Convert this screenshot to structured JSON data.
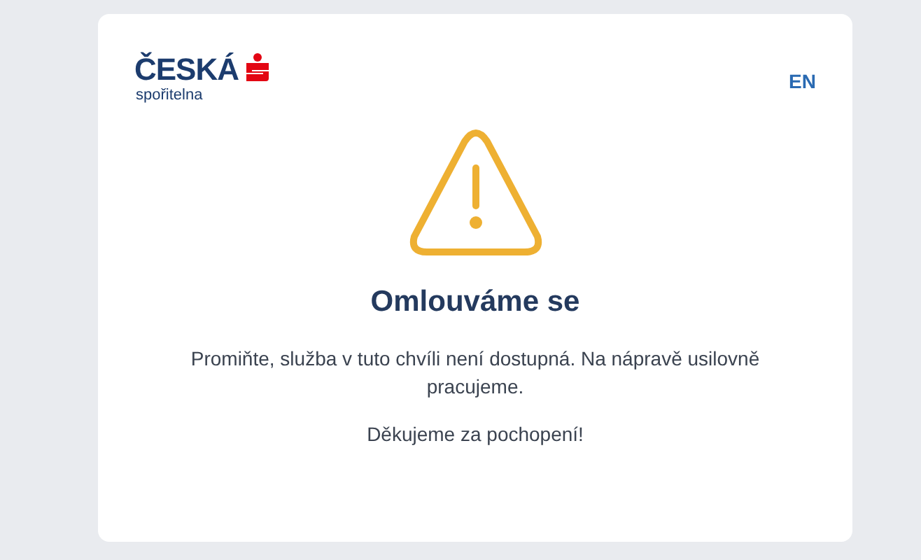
{
  "logo": {
    "name": "ČESKÁ",
    "subtitle": "spořitelna"
  },
  "language_link": "EN",
  "title": "Omlouváme se",
  "paragraphs": [
    "Promiňte, služba v tuto chvíli není dostupná. Na nápravě usilovně pracujeme.",
    "Děkujeme za pochopení!"
  ]
}
